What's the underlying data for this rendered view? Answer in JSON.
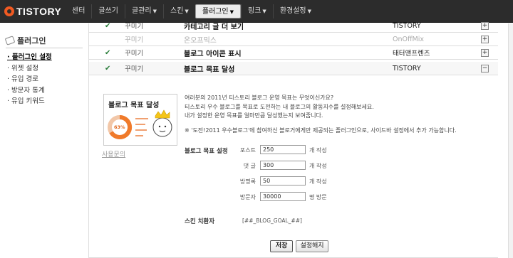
{
  "brand": "TISTORY",
  "nav": [
    "센터",
    "글쓰기",
    "글관리",
    "스킨",
    "플러그인",
    "링크",
    "환경설정"
  ],
  "nav_has_caret": [
    false,
    false,
    true,
    true,
    true,
    true,
    true
  ],
  "sidebar": {
    "title": "플러그인",
    "items": [
      "플러그인 설정",
      "위젯 설정",
      "유입 경로",
      "방문자 통계",
      "유입 키워드"
    ]
  },
  "rows": [
    {
      "check": "✔",
      "cat": "꾸미기",
      "name": "카테고리 글 더 보기",
      "author": "TISTORY",
      "toggle": "+"
    },
    {
      "check": "",
      "cat": "꾸미기",
      "name": "온오프믹스",
      "author": "OnOffMix",
      "toggle": "+"
    },
    {
      "check": "✔",
      "cat": "꾸미기",
      "name": "블로그 아이콘 표시",
      "author": "태터앤프렌즈",
      "toggle": "+"
    },
    {
      "check": "✔",
      "cat": "꾸미기",
      "name": "블로그 목표 달성",
      "author": "TISTORY",
      "toggle": "−"
    }
  ],
  "plugin": {
    "thumb_title": "블로그 목표 달성",
    "thumb_percent": "63%",
    "manual": "사용문의",
    "desc": [
      "여러분의 2011년 티스토리 블로그 운영 목표는 무엇이신가요?",
      "티스토리 우수 블로그를 목표로 도전하는 내 블로그의 활동지수를 설정해보세요.",
      "내가 설정한 운영 목표를 얼마만큼 달성했는지 보여줍니다."
    ],
    "note": "※ '도전!2011 우수블로그'에 참여하신 블로거에게만 제공되는 플러그인으로, 사이드바 설정에서 추가 가능합니다.",
    "form_label": "블로그 목표 설정",
    "fields": [
      {
        "label": "포스트",
        "value": "250",
        "unit": "개 작성"
      },
      {
        "label": "댓  글",
        "value": "300",
        "unit": "개 작성"
      },
      {
        "label": "방명록",
        "value": "50",
        "unit": "개 작성"
      },
      {
        "label": "방문자",
        "value": "30000",
        "unit": "명 방문"
      }
    ],
    "skin_label": "스킨 치환자",
    "skin_value": "[##_BLOG_GOAL_##]"
  },
  "buttons": {
    "save": "저장",
    "cancel": "설정해지"
  }
}
